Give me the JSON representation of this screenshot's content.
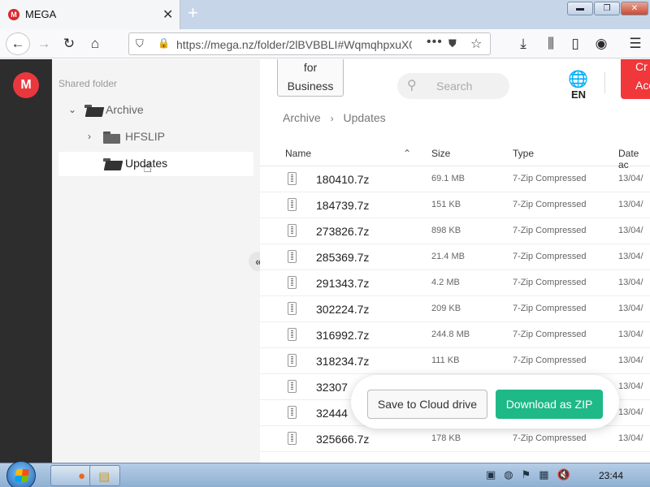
{
  "browser": {
    "tab_title": "MEGA",
    "favicon_letter": "M",
    "url": "https://mega.nz/folder/2lBVBBLI#WqmqhpxuX0",
    "new_tab_symbol": "+",
    "close_symbol": "✕"
  },
  "mega": {
    "logo_letter": "M",
    "business_label_line1": "for",
    "business_label_line2": "Business",
    "search_placeholder": "Search",
    "language": "EN",
    "create_account_line1": "Cr",
    "create_account_line2": "Acc"
  },
  "tree": {
    "heading": "Shared folder",
    "items": [
      {
        "label": "Archive"
      },
      {
        "label": "HFSLIP"
      },
      {
        "label": "Updates"
      }
    ]
  },
  "breadcrumb": [
    "Archive",
    "Updates"
  ],
  "columns": {
    "name": "Name",
    "size": "Size",
    "type": "Type",
    "date": "Date ac"
  },
  "files": [
    {
      "name": "180410.7z",
      "size": "69.1 MB",
      "type": "7-Zip Compressed",
      "date": "13/04/"
    },
    {
      "name": "184739.7z",
      "size": "151 KB",
      "type": "7-Zip Compressed",
      "date": "13/04/"
    },
    {
      "name": "273826.7z",
      "size": "898 KB",
      "type": "7-Zip Compressed",
      "date": "13/04/"
    },
    {
      "name": "285369.7z",
      "size": "21.4 MB",
      "type": "7-Zip Compressed",
      "date": "13/04/"
    },
    {
      "name": "291343.7z",
      "size": "4.2 MB",
      "type": "7-Zip Compressed",
      "date": "13/04/"
    },
    {
      "name": "302224.7z",
      "size": "209 KB",
      "type": "7-Zip Compressed",
      "date": "13/04/"
    },
    {
      "name": "316992.7z",
      "size": "244.8 MB",
      "type": "7-Zip Compressed",
      "date": "13/04/"
    },
    {
      "name": "318234.7z",
      "size": "111 KB",
      "type": "7-Zip Compressed",
      "date": "13/04/"
    },
    {
      "name": "32307",
      "size": "",
      "type": "",
      "date": "13/04/"
    },
    {
      "name": "32444",
      "size": "",
      "type": "",
      "date": "13/04/"
    },
    {
      "name": "325666.7z",
      "size": "178 KB",
      "type": "7-Zip Compressed",
      "date": "13/04/"
    }
  ],
  "actions": {
    "save_to_cloud": "Save to Cloud drive",
    "download_zip": "Download as ZIP"
  },
  "taskbar": {
    "clock": "23:44"
  },
  "colors": {
    "mega_red": "#e9373e",
    "download_green": "#1fb887",
    "rail": "#2d2d2d"
  }
}
